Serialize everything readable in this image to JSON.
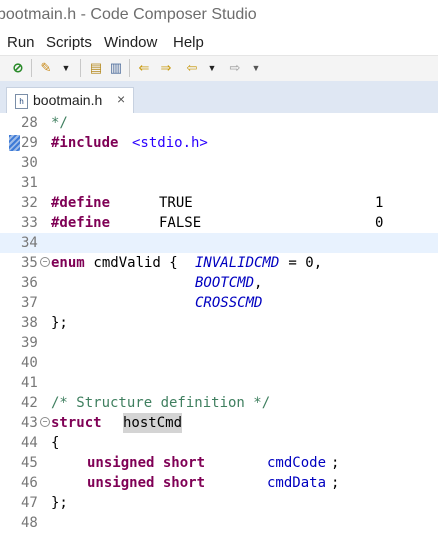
{
  "window": {
    "title": "bootmain.h - Code Composer Studio"
  },
  "menu": [
    "Run",
    "Scripts",
    "Window",
    "Help"
  ],
  "toolbar": {
    "icons": [
      "no-entry-icon",
      "wand-icon",
      "dropdown-arrow-icon",
      "tag-icon",
      "document-icon",
      "back-arrow-icon",
      "forward-arrow-icon",
      "nav-back-icon",
      "dropdown-arrow-icon",
      "nav-forward-icon",
      "dropdown-arrow-icon"
    ]
  },
  "tab": {
    "label": "bootmain.h",
    "file_icon_letter": "h",
    "close_glyph": "×"
  },
  "editor": {
    "current_line": 34,
    "lines": [
      {
        "n": "28",
        "text": "*/"
      },
      {
        "n": "29",
        "hash": "#include",
        "header": "<stdio.h>"
      },
      {
        "n": "30"
      },
      {
        "n": "31"
      },
      {
        "n": "32",
        "define": "#define",
        "name": "TRUE",
        "value": "1"
      },
      {
        "n": "33",
        "define": "#define",
        "name": "FALSE",
        "value": "0"
      },
      {
        "n": "34"
      },
      {
        "n": "35",
        "kw": "enum",
        "rest": " cmdValid { ",
        "enum1": "INVALIDCMD",
        "tail": " = 0,"
      },
      {
        "n": "36",
        "enum": "BOOTCMD",
        "punct": ","
      },
      {
        "n": "37",
        "enum": "CROSSCMD"
      },
      {
        "n": "38",
        "text": "};"
      },
      {
        "n": "39"
      },
      {
        "n": "40"
      },
      {
        "n": "41"
      },
      {
        "n": "42",
        "comment": "/* Structure definition */"
      },
      {
        "n": "43",
        "kw": "struct",
        "ident": "hostCmd"
      },
      {
        "n": "44",
        "text": "{"
      },
      {
        "n": "45",
        "type": "unsigned short",
        "field": "cmdCode",
        "punct": ";"
      },
      {
        "n": "46",
        "type": "unsigned short",
        "field": "cmdData",
        "punct": ";"
      },
      {
        "n": "47",
        "text": "};"
      },
      {
        "n": "48"
      }
    ]
  }
}
